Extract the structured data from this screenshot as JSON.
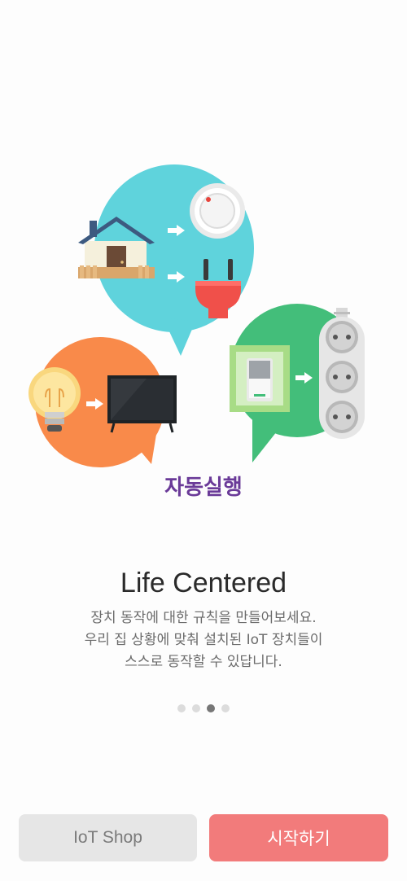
{
  "illustration": {
    "caption": "자동실행",
    "icons": [
      "house-icon",
      "dial-icon",
      "plug-icon",
      "bulb-icon",
      "tv-icon",
      "switch-icon",
      "power-strip-icon",
      "arrow-icon"
    ],
    "colors": {
      "cyan": "#5fd3dc",
      "orange": "#f98a4a",
      "green": "#43be7a",
      "caption": "#6a3a98"
    }
  },
  "content": {
    "title": "Life Centered",
    "description": [
      "장치 동작에 대한 규칙을 만들어보세요.",
      "우리 집 상황에 맞춰 설치된 IoT 장치들이",
      "스스로 동작할 수 있답니다."
    ]
  },
  "pager": {
    "total": 4,
    "active": 3
  },
  "buttons": {
    "shop_label": "IoT Shop",
    "start_label": "시작하기"
  },
  "colors": {
    "start_button": "#f27b7b",
    "shop_button": "#e6e6e6"
  }
}
